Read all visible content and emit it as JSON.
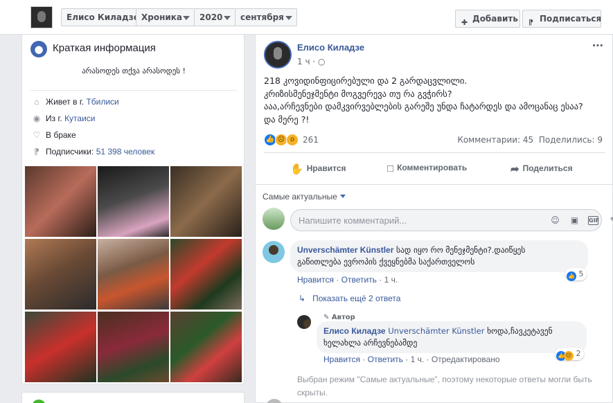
{
  "breadcrumbs": [
    "Елисо Киладзе",
    "Хроника",
    "2020",
    "сентября"
  ],
  "top_buttons": {
    "add": "Добавить",
    "subscribe": "Подписаться"
  },
  "intro": {
    "title": "Краткая информация",
    "bio": "არასოდეს თქვა არასოდეს !",
    "lives_prefix": "Живет в г.",
    "lives_city": "Tбилиси",
    "from_prefix": "Из г.",
    "from_city": "Кутаиси",
    "relationship": "В браке",
    "followers_prefix": "Подписчики:",
    "followers_count": "51 398 человек"
  },
  "post": {
    "author": "Елисо Киладзе",
    "time": "1 ч",
    "text_lines": [
      "218 კოვიდინფიცირებული და 2 გარდაცვლილი.",
      "კრიზისმენეჯმენტი მოგვერევა თუ რა გვჭირს?",
      "ააა,არჩევნები დამკვირვებლების გარეშე უნდა ჩატარდეს და ამოცანაც ესაა?",
      "და მერე ?!"
    ],
    "reactions_count": "261",
    "comments_stat": "Комментарии: 45",
    "shares_stat": "Поделились: 9",
    "actions": {
      "like": "Нравится",
      "comment": "Комментировать",
      "share": "Поделиться"
    }
  },
  "comments_section": {
    "sort_label": "Самые актуальные",
    "input_placeholder": "Напишите комментарий...",
    "comment1": {
      "name": "Unverschämter Künstler",
      "text_line1": "სად იყო რო მენეჯმენტი?.დაიწყეს",
      "text_line2": "გაწითლება ევროპის ქვეყნებმა საქართველოს",
      "like": "Нравится",
      "reply": "Ответить",
      "time": "1 ч.",
      "reactions": "5"
    },
    "more_replies": "Показать ещё 2 ответа",
    "reply1": {
      "author_tag": "Автор",
      "name": "Елисо Киладзе",
      "mention": "Unverschämter Künstler",
      "text_inline": "ხოდა,ჩავკეტავენ",
      "text_line2": "ხელახლა არჩევნებამდე",
      "like": "Нравится",
      "reply": "Ответить",
      "time": "1 ч.",
      "edited": "Отредактировано",
      "reactions": "2"
    },
    "note": "Выбран режим \"Самые актуальные\", поэтому некоторые ответы могли быть скрыты."
  },
  "icons": {
    "globe": "globe-icon",
    "home": "home-icon",
    "location": "location-pin-icon",
    "heart": "heart-icon",
    "rss": "rss-icon",
    "like": "thumbs-up-icon",
    "comment": "speech-bubble-icon",
    "share": "share-arrow-icon"
  },
  "colors": {
    "link": "#385898",
    "brand": "#4267b2",
    "bg": "#e9ebee"
  }
}
